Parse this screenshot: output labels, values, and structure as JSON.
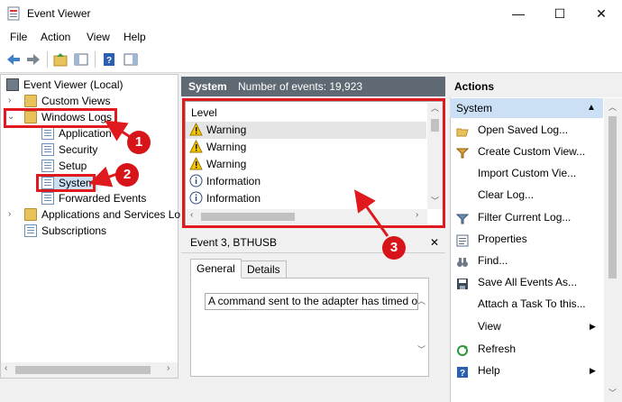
{
  "window": {
    "title": "Event Viewer",
    "minimize_glyph": "—",
    "maximize_glyph": "☐",
    "close_glyph": "✕"
  },
  "menu": [
    "File",
    "Action",
    "View",
    "Help"
  ],
  "tree": {
    "root": "Event Viewer (Local)",
    "custom_views": "Custom Views",
    "windows_logs": "Windows Logs",
    "application": "Application",
    "security": "Security",
    "setup": "Setup",
    "system": "System",
    "forwarded": "Forwarded Events",
    "apps_services": "Applications and Services Lo",
    "subscriptions": "Subscriptions"
  },
  "center": {
    "log_name": "System",
    "count_text": "Number of events: 19,923",
    "column_header": "Level",
    "rows": [
      {
        "level": "Warning",
        "type": "warning"
      },
      {
        "level": "Warning",
        "type": "warning"
      },
      {
        "level": "Warning",
        "type": "warning"
      },
      {
        "level": "Information",
        "type": "info"
      },
      {
        "level": "Information",
        "type": "info"
      }
    ],
    "event_title": "Event 3, BTHUSB",
    "tabs": [
      "General",
      "Details"
    ],
    "description": "A command sent to the adapter has timed o"
  },
  "actions": {
    "title": "Actions",
    "section": "System",
    "items": [
      {
        "label": "Open Saved Log...",
        "icon": "folder-open-icon"
      },
      {
        "label": "Create Custom View...",
        "icon": "filter-icon"
      },
      {
        "label": "Import Custom Vie...",
        "icon": "none"
      },
      {
        "label": "Clear Log...",
        "icon": "none"
      },
      {
        "label": "Filter Current Log...",
        "icon": "filter-icon"
      },
      {
        "label": "Properties",
        "icon": "properties-icon"
      },
      {
        "label": "Find...",
        "icon": "binoculars-icon"
      },
      {
        "label": "Save All Events As...",
        "icon": "save-icon"
      },
      {
        "label": "Attach a Task To this...",
        "icon": "none"
      },
      {
        "label": "View",
        "icon": "none"
      },
      {
        "label": "Refresh",
        "icon": "refresh-icon"
      },
      {
        "label": "Help",
        "icon": "help-icon"
      }
    ]
  },
  "callouts": [
    "1",
    "2",
    "3"
  ],
  "colors": {
    "accent_red": "#e0191f",
    "header_gray": "#5e6974",
    "selection_blue": "#cce0f5"
  }
}
